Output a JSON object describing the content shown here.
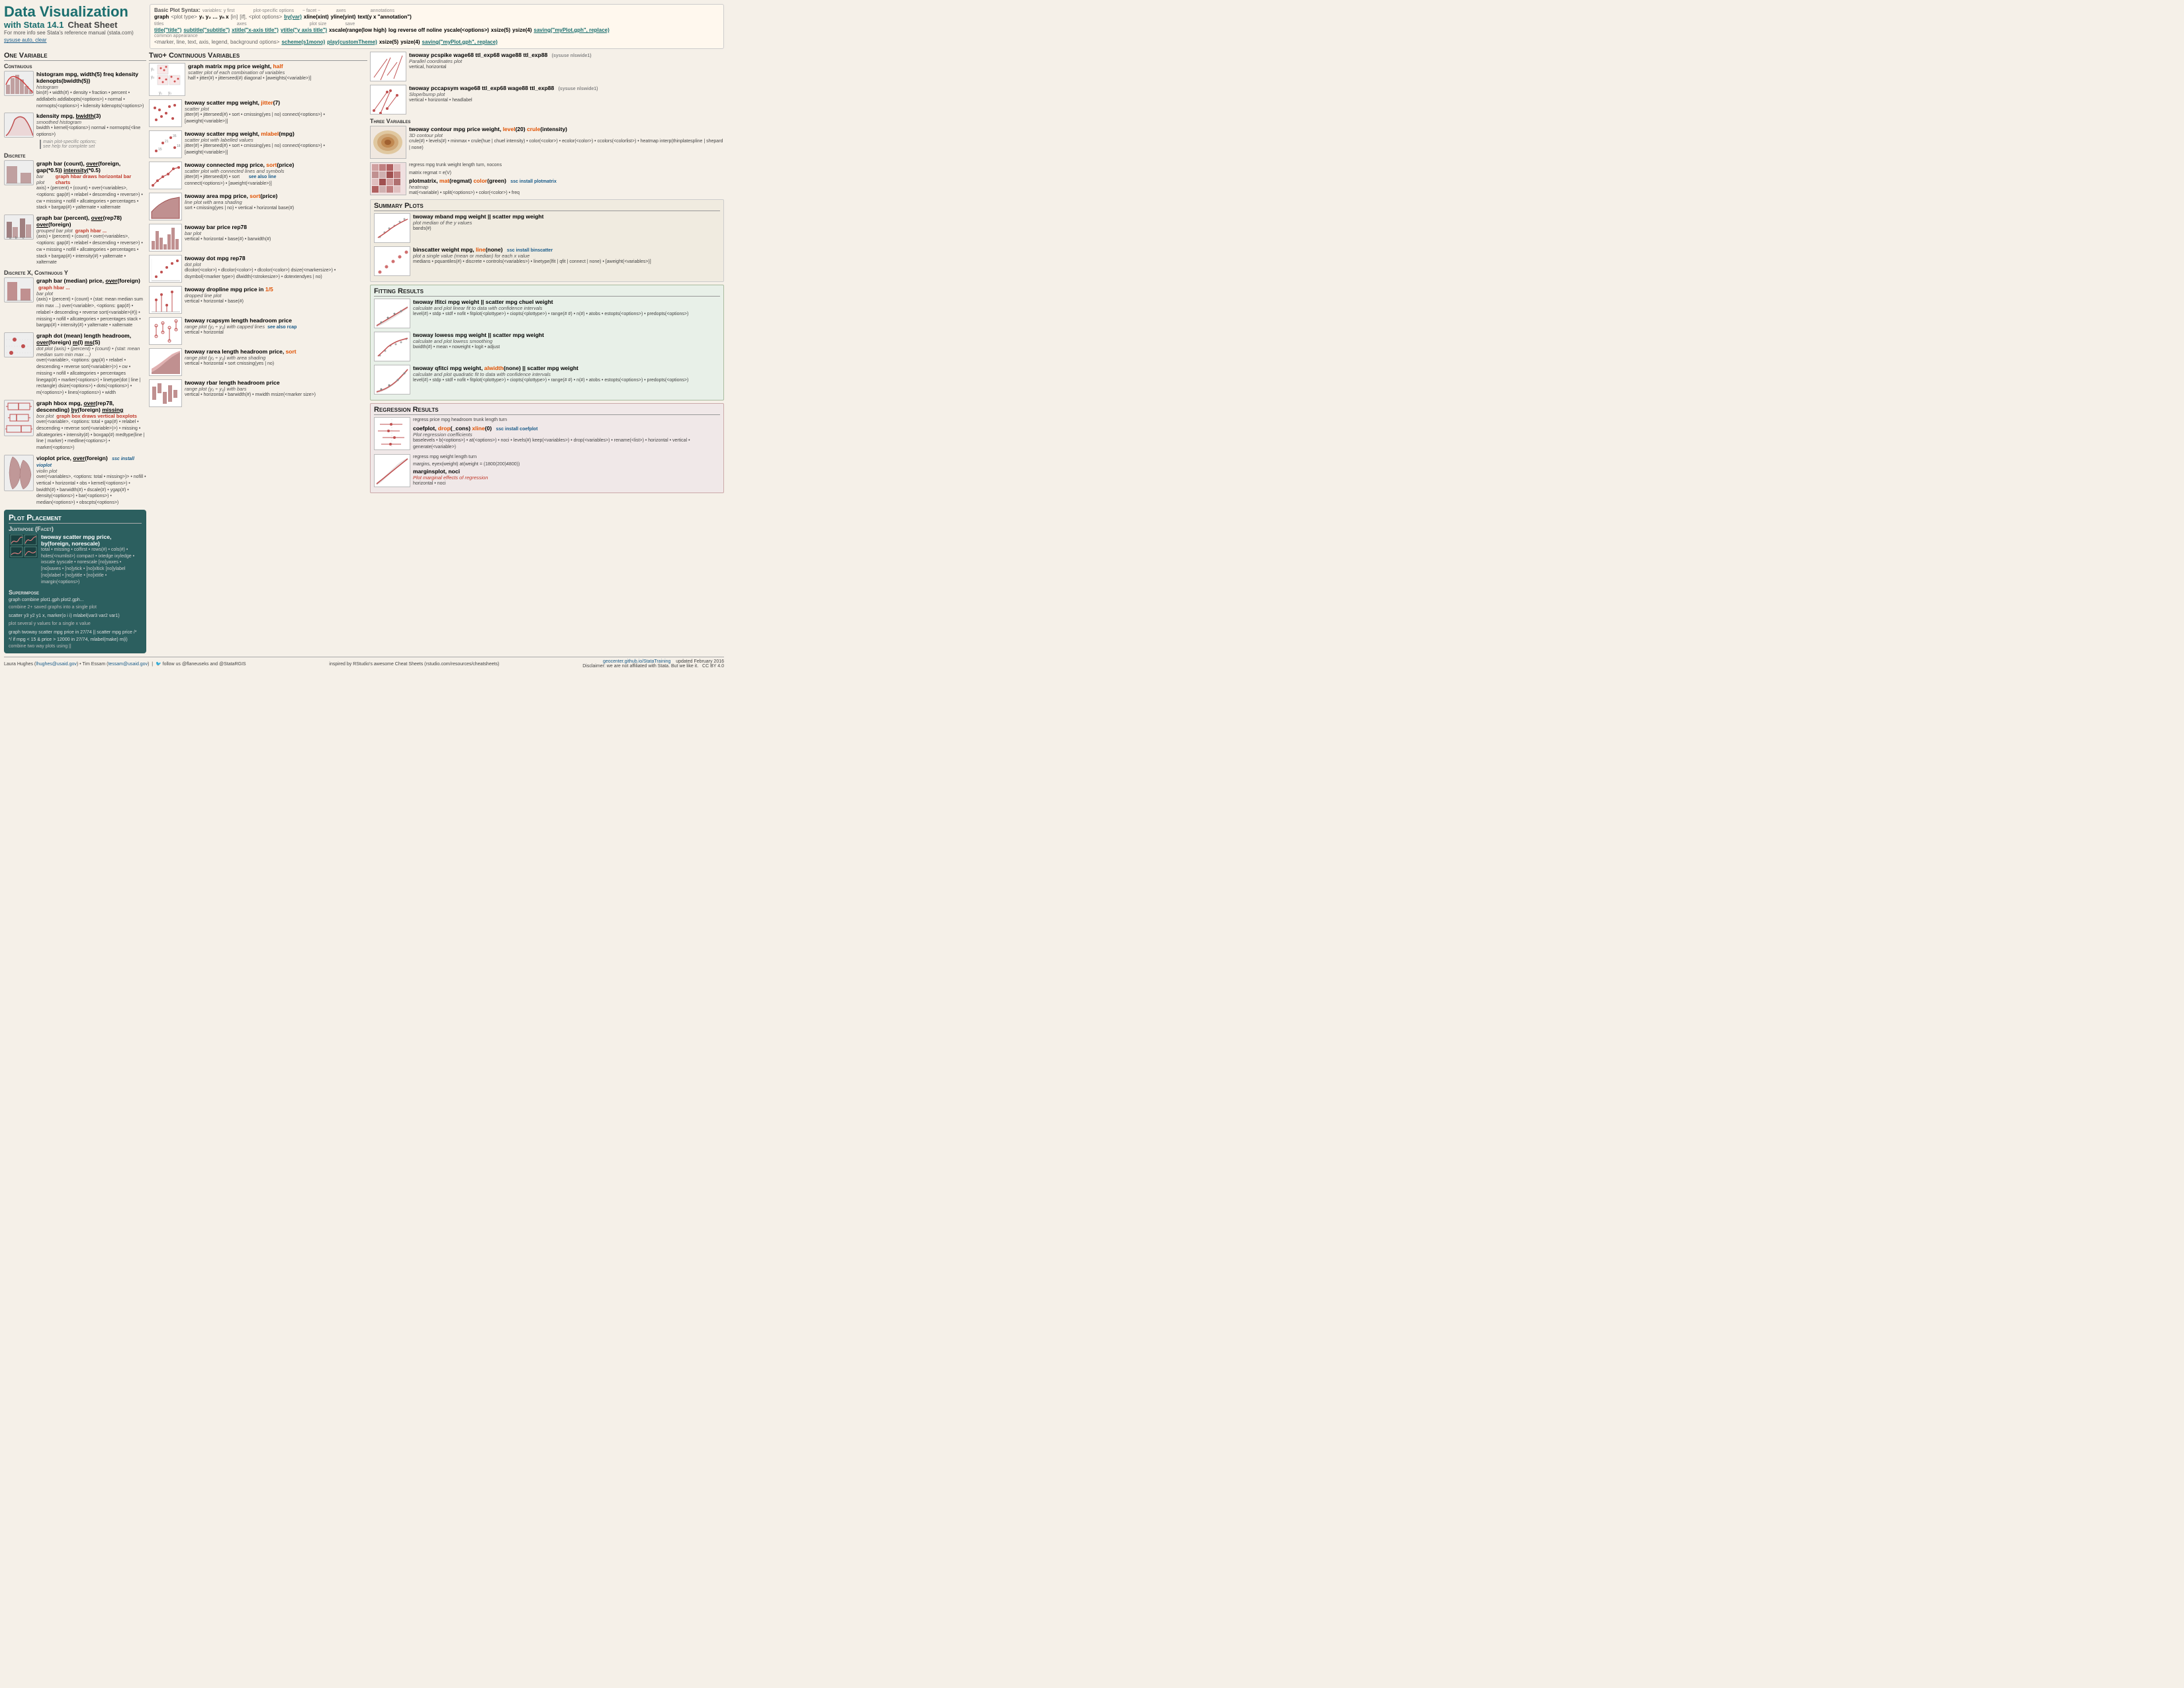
{
  "header": {
    "title": "Data Visualization",
    "subtitle_line1": "with Stata 14.1",
    "subtitle_line2": "Cheat Sheet",
    "info": "For more info see Stata's reference manual (stata.com)",
    "clear_link": "sysuse auto, clear"
  },
  "syntax": {
    "label": "Basic Plot Syntax:",
    "graph_cmd": "graph",
    "plot_type": "<plot type>",
    "vars_label": "variables: y first",
    "vars": "y₁ y₂ … yₙ x",
    "in_bracket": "[in]",
    "if_bracket": "[if],",
    "plot_opts": "<plot options>",
    "facet": "− facet −",
    "by_var": "by(var)",
    "axes_label": "axes",
    "xline": "xline(xint)",
    "yline": "yline(yint)",
    "annotations": "annotations",
    "text": "text(y x \"annotation\")",
    "titles_label": "titles",
    "title": "title(\"title\")",
    "subtitle": "subtitle(\"subtitle\")",
    "xtitle": "xtitle(\"x-axis title\")",
    "ytitle": "ytitle(\"y axis title\")",
    "xscale": "xscale(range(low high)",
    "log_reverse": "log reverse off noline",
    "yscale": "yscale(<options>)",
    "common_label": "common appearance",
    "marker_etc": "<marker, line, text, axis, legend, background options>",
    "scheme": "scheme(s1mono)",
    "play": "play(customTheme)",
    "xsize": "xsize(5)",
    "ysize": "ysize(4)",
    "saving": "saving(\"myPlot.gph\", replace)",
    "plot_size_label": "plot size",
    "save_label": "save"
  },
  "one_variable": {
    "header": "One Variable",
    "continuous_header": "Continuous",
    "histogram_cmd": "histogram mpg, width(5) freq kdensity kdenopts(bwidth(5))",
    "histogram_sub": "histogram",
    "histogram_opts": "bin(#) • width(#) • density • fraction • percent • addlabels\naddlabopts(<options>) • normal • normopts(<options>) • kdensity\nkdenopts(<options>)",
    "kdensity_cmd": "kdensity mpg, bwidth(3)",
    "kdensity_sub": "smoothed histogram",
    "kdensity_opts": "bwidth • kernel(<options>)\nnormal • normopts(<line options>)",
    "discrete_header": "Discrete",
    "graph_bar_cmd": "graph bar (count), over(foreign, gap(*0.5)) intensity(*0.5)",
    "graph_bar_sub": "bar plot",
    "graph_hbar_note": "graph hbar draws horizontal bar charts",
    "graph_bar_opts": "axis) • (percent) • (count) • over(<variables>, <options: gap(#) •\nrelabel • descending • reverse>) • cw • missing • nofill • allcategories •\npercentages • stack • bargap(#) • yalternate • xalternate",
    "graph_bar2_cmd": "graph bar (percent), over(rep78) over(foreign)",
    "graph_bar2_sub": "grouped bar plot",
    "graph_hbar2_note": "graph hbar ...",
    "graph_bar2_opts": "(axis) • (percent) • (count) • over(<variables>, <options: gap(#) •\nrelabel • descending • reverse>) • cw • missing • nofill •\nallcategories • percentages • stack • bargap(#) • intensity(#) • yalternate • xalternate",
    "discrete_x_cont_y_header": "Discrete X, Continuous Y",
    "graph_bar_median_cmd": "graph bar (median) price, over(foreign)",
    "graph_bar_median_hbar_note": "graph hbar ...",
    "graph_bar_median_sub": "bar plot",
    "graph_bar_median_opts": "(axis) • (percent) • (count) • (stat: mean median sum min max ...)\nover(<variable>, <options: gap(#) • relabel • descending • reverse\nsort(<variable>(#)) • missing • nofill • allcategories • percentages\nstack • bargap(#) • intensity(#) • yalternate • xalternate",
    "graph_dot_cmd": "graph dot (mean) length headroom, over(foreign) m(l) ms(S)",
    "graph_dot_sub": "dot plot (axis) • (percent) • (count) • (stat: mean median sum min max ...)",
    "graph_dot_opts": "over(<variable>, <options: gap(#) • relabel • descending • reverse\nsort(<variable>)>) • cw • missing • nofill • allcategories • percentages\nlinegap(#) • marker(<options>) • linetype(dot | line | rectangle)\ndsize(<options>) • dots(<options>) • m(<options>) • lines(<options>) • width",
    "graph_hbox_cmd": "graph hbox mpg, over(rep78, descending) by(foreign) missing",
    "graph_hbox_sub": "box plot",
    "graph_box_note": "graph box draws vertical boxplots",
    "graph_hbox_opts": "over(<variable>, <options: total • gap(#) • relabel • descending • reverse\nsort(<variable>)>) • missing • allcategories • intensity(#) • boxgap(#)\nmedtype(line | line | marker) • medline(<options>) • marker(<options>)",
    "vioplot_cmd": "vioplot price, over(foreign)",
    "vioplot_sub": "violin plot",
    "vioplot_ssc": "ssc install vioplot",
    "vioplot_opts": "over(<variables>, <options: total • missing>)> • nofill •\nvertical • horizontal • obs • kernel(<options>) • bwidth(#) •\nbarwidth(#) • dscale(#) • ygap(#) • density(<options>) • bar(<options>) • median(<options>) • obscpts(<options>)"
  },
  "plot_placement": {
    "header": "Plot Placement",
    "juxtapose_header": "Juxtapose (Facet)",
    "twoway_scatter_cmd": "twoway scatter mpg price, by(foreign, norescale)",
    "twoway_scatter_opts": "total • missing • colfirst • rows(#) • cols(#) • holes(<numlist>)\ncompact • ixtedge ixyledge • ixscale iyyscale • norescale\n[no]yaxes • [no]xaxes • [no]ytick • [no]xltick [no]ylabel\n[no]xlabel • [no]ytitle • [no]xtitle • imargin(<options>)",
    "superimpose_header": "Superimpose",
    "graph_combine_cmd": "graph combine plot1.gph plot2.gph...",
    "graph_combine_sub": "combine 2+ saved graphs into a single plot",
    "scatter_cmd": "scatter y3 y2 y1 x, marker(o i i) mlabel(var3 var2 var1)",
    "scatter_sub": "plot several y values for a single x value",
    "twoway_scatter2_cmd": "graph twoway scatter mpg price in 27/74 || scatter mpg price /*",
    "twoway_scatter2_sub": "*/ if mpg < 15  & price > 12000 in 27/74, mlabel(make) m(i)",
    "twoway_combine_sub": "combine two way plots using ||"
  },
  "two_plus_vars": {
    "header": "Two+ Continuous Variables",
    "graph_matrix_cmd": "graph matrix mpg price weight, half",
    "graph_matrix_sub": "scatter plot of each combination of variables",
    "graph_matrix_opts": "half • jitter(#) • jitterseed(#)\ndiagonal • [aweights(<variable>)]",
    "twoway_scatter_cmd": "twoway scatter mpg weight, jitter(7)",
    "twoway_scatter_sub": "scatter plot",
    "twoway_scatter_opts": "jitter(#) • jitterseed(#) • sort • cmissing(yes | no)\nconnect(<options>) • [aweight(<variable>)]",
    "twoway_scatter_mlabel_cmd": "twoway scatter mpg weight, mlabel(mpg)",
    "twoway_scatter_mlabel_sub": "scatter plot with labelled values",
    "twoway_scatter_mlabel_opts": "jitter(#) • jitterseed(#) • sort • cmissing(yes | no)\nconnect(<options>) • [aweight(<variable>)]",
    "twoway_connected_cmd": "twoway connected mpg price, sort(price)",
    "twoway_connected_sub": "scatter plot with connected lines and symbols",
    "twoway_connected_opts": "jitter(#) • jitterseed(#) • sort",
    "see_also_line": "see also line",
    "twoway_area_cmd": "twoway area mpg price, sort(price)",
    "twoway_area_sub": "line plot with area shading",
    "twoway_area_opts": "sort • cmissing(yes | no) • vertical • horizontal\nbase(#)",
    "twoway_bar_cmd": "twoway bar price rep78",
    "twoway_bar_sub": "bar plot",
    "twoway_bar_opts": "vertical • horizontal • base(#) • barwidth(#)",
    "twoway_dot_cmd": "twoway dot mpg rep78",
    "twoway_dot_sub": "dot plot",
    "twoway_dot_opts": "dlcolor(<color>) • dlcolor(<color>) • dlcolor(<color>)\ndsize(<markersize>) • dsymbol(<marker type>)\ndlwidth(<strokesize>) • dotextendyes | no)",
    "twoway_dropline_cmd": "twoway dropline mpg price in 1/5",
    "twoway_dropline_sub": "dropped line plot",
    "twoway_dropline_opts": "vertical • horizontal • base(#)",
    "twoway_rcapsym_cmd": "twoway rcapsym length headroom price",
    "twoway_rcapsym_sub": "range plot (y₁ ÷ y₂) with capped lines",
    "twoway_rcapsym_see": "see also rcap",
    "twoway_rcapsym_opts": "vertical • horizontal",
    "twoway_rarea_cmd": "twoway rarea length headroom price, sort",
    "twoway_rarea_sub": "range plot (y₁ ÷ y₂) with area shading",
    "twoway_rarea_opts": "vertical • horizontal • sort\ncmissing(yes | no)",
    "twoway_rbar_cmd": "twoway rbar length headroom price",
    "twoway_rbar_sub": "range plot (y₁ ÷ y₂) with bars",
    "twoway_rbar_opts": "vertical • horizontal • barwidth(#) • mwidth\nmsize(<marker size>)"
  },
  "right_col": {
    "pcspike_cmd": "twoway pcspike wage68 ttl_exp68 wage88 ttl_exp88",
    "pcspike_sub": "Parallel coordinates plot",
    "pcspike_opts": "vertical, horizontal",
    "pcspike_ssc": "(sysuse nlswide1)",
    "pccapsym_cmd": "twoway pccapsym wage68 ttl_exp68 wage88 ttl_exp88",
    "pccapsym_sub": "Slope/bump plot",
    "pccapsym_opts": "vertical • horizontal • headlabel",
    "pccapsym_ssc": "(sysuse nlswide1)",
    "three_vars_header": "Three Variables",
    "contour_cmd": "twoway contour mpg price weight, level(20) crule(intensity)",
    "contour_sub": "3D contour plot",
    "contour_opts": "crule(#) • levels(#) • minmax • crule(hue | chuel intensity) •\ncolor(<color>) • ecolor(<color>) • ccolors(<colorlist>) • heatmap\ninterp(thinplatespline | shepard | none)",
    "regress_cmd": "regress mpg trunk weight length turn, nocons",
    "matrix_cmd": "matrix regmat = e(V)",
    "plotmatrix_cmd": "plotmatrix, mat(regmat) color(green)",
    "plotmatrix_sub": "heatmap",
    "plotmatrix_opts": "mat(<variable) • split(<options>) • color(<color>) • freq",
    "plotmatrix_ssc": "ssc install plotmatrix",
    "summary_plots_header": "Summary Plots",
    "twoway_mband_cmd": "twoway mband mpg weight || scatter mpg weight",
    "twoway_mband_sub": "plot median of the y values",
    "twoway_mband_opts": "bands(#)",
    "binscatter_cmd": "binscatter weight mpg, line(none)",
    "binscatter_sub": "plot a single value (mean or median) for each x value",
    "binscatter_ssc": "ssc install binscatter",
    "binscatter_opts": "medians • pquantiles(#) • discrete • controls(<variables>) •\nlinetype(lfit | qfit | connect | none) • [aweight(<variables>)]",
    "fitting_results_header": "Fitting Results",
    "twoway_lfitci_cmd": "twoway lfitci mpg weight || scatter mpg chuel weight",
    "twoway_lfitci_sub": "calculate and plot linear fit to data with confidence intervals",
    "twoway_lfitci_opts": "level(#) • stdp • stdf • nofit • fitplot(<plottype>) • ciopts(<plottype>) •\nrange(# #) • n(#) • atobs • estopts(<options>) • predopts(<options>)",
    "twoway_lowess_cmd": "twoway lowess mpg weight || scatter mpg weight",
    "twoway_lowess_sub": "calculate and plot lowess smoothing",
    "twoway_lowess_opts": "bwidth(#) • mean • noweight • logit • adjust",
    "twoway_qfitci_cmd": "twoway qfitci mpg weight, alwidth(none) || scatter mpg weight",
    "twoway_qfitci_sub": "calculate and plot quadratic fit to data with confidence intervals",
    "twoway_qfitci_opts": "level(#) • stdp • stdf • nofit • fitplot(<plottype>) • ciopts(<plottype>) •\nrange(# #) • n(#) • atobs • estopts(<options>) • predopts(<options>)",
    "regression_results_header": "Regression Results",
    "regress2_cmd": "regress price mpg headroom trunk length turn",
    "coefplot_cmd": "coefplot, drop(_cons) xline(0)",
    "coefplot_sub": "Plot regression coefficients",
    "coefplot_ssc": "ssc install coefplot",
    "coefplot_opts": "baselevels • b(<options>) • at(<options>) • noci • levels(#)\nkeep(<variables>) • drop(<variables>) • rename(<list>) •\nhorizontal • vertical • generate(<variable>)",
    "regress3_cmd": "regress mpg weight length turn",
    "margins_cmd": "margins, eyex(weight) at(weight = (1800(200)4800))",
    "marginsplot_cmd": "marginsplot, noci",
    "marginsplot_sub": "Plot marginal effects of regression",
    "marginsplot_opts": "horizontal • noci"
  },
  "footer": {
    "author1": "Laura Hughes",
    "email1": "lhughes@usaid.gov",
    "author2": "Tim Essam",
    "email2": "tessam@usaid.gov",
    "inspired": "inspired by RStudio's awesome Cheat Sheets (rstudio.com/resources/cheatsheets)",
    "geocenter": "geocenter.github.io/StataTraining",
    "updated": "updated February 2016",
    "twitter": "follow us @flaneuseks and @StataRGIS",
    "disclaimer": "Disclaimer: we are not affiliated with Stata. But we like it.",
    "license": "CC BY 4.0"
  }
}
